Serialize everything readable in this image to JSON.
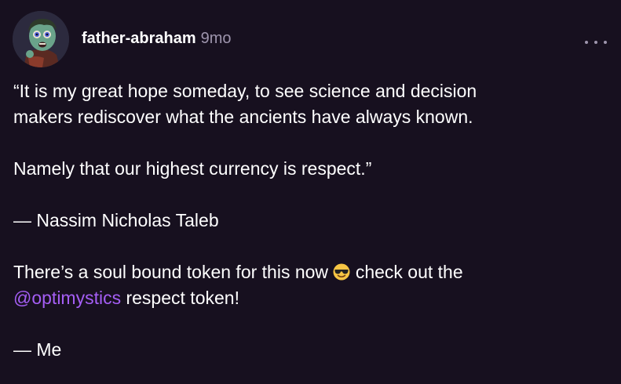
{
  "post": {
    "username": "father-abraham",
    "timestamp": "9mo",
    "more_icon": "more-horizontal-icon",
    "quote_line1": "“It is my great hope someday, to see science and decision",
    "quote_line2": "makers rediscover what the ancients have always known.",
    "quote_line3": "Namely that our highest currency is respect.”",
    "attribution": "— Nassim Nicholas Taleb",
    "token_line1_before": "There’s a soul bound token for this now ",
    "token_emoji": "smiling-face-with-sunglasses-emoji",
    "token_line1_after": " check out the",
    "mention": "@optimystics",
    "token_line2_after": " respect token!",
    "signature": "— Me"
  },
  "colors": {
    "background": "#17101f",
    "text": "#ffffff",
    "muted": "#9e95ad",
    "mention": "#a55ef5"
  }
}
